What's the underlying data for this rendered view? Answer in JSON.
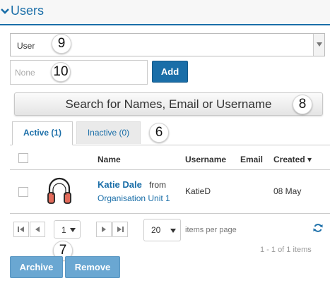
{
  "header": {
    "title": "Users",
    "icon": "chevron-down-icon"
  },
  "filter": {
    "type_select_value": "User",
    "name_input_placeholder": "None",
    "add_label": "Add"
  },
  "search": {
    "label": "Search for Names, Email or Username"
  },
  "tabs": [
    {
      "label": "Active (1)",
      "active": true
    },
    {
      "label": "Inactive (0)",
      "active": false
    }
  ],
  "table": {
    "columns": [
      "Name",
      "Username",
      "Email",
      "Created ▾"
    ],
    "rows": [
      {
        "name": "Katie Dale",
        "from_text": "from",
        "organisation": "Organisation Unit 1",
        "username": "KatieD",
        "email": "",
        "created": "08 May",
        "avatar_icon": "headphones-icon"
      }
    ]
  },
  "pager": {
    "page": "1",
    "page_size": "20",
    "items_per_page_label": "items per page",
    "summary": "1 - 1 of 1 items"
  },
  "actions": {
    "archive_label": "Archive",
    "remove_label": "Remove"
  },
  "callouts": {
    "select": "9",
    "name_input": "10",
    "search": "8",
    "tabs": "6",
    "pager": "7"
  },
  "colors": {
    "accent": "#1a6ea8",
    "disabled_button": "#6aa7d2"
  }
}
